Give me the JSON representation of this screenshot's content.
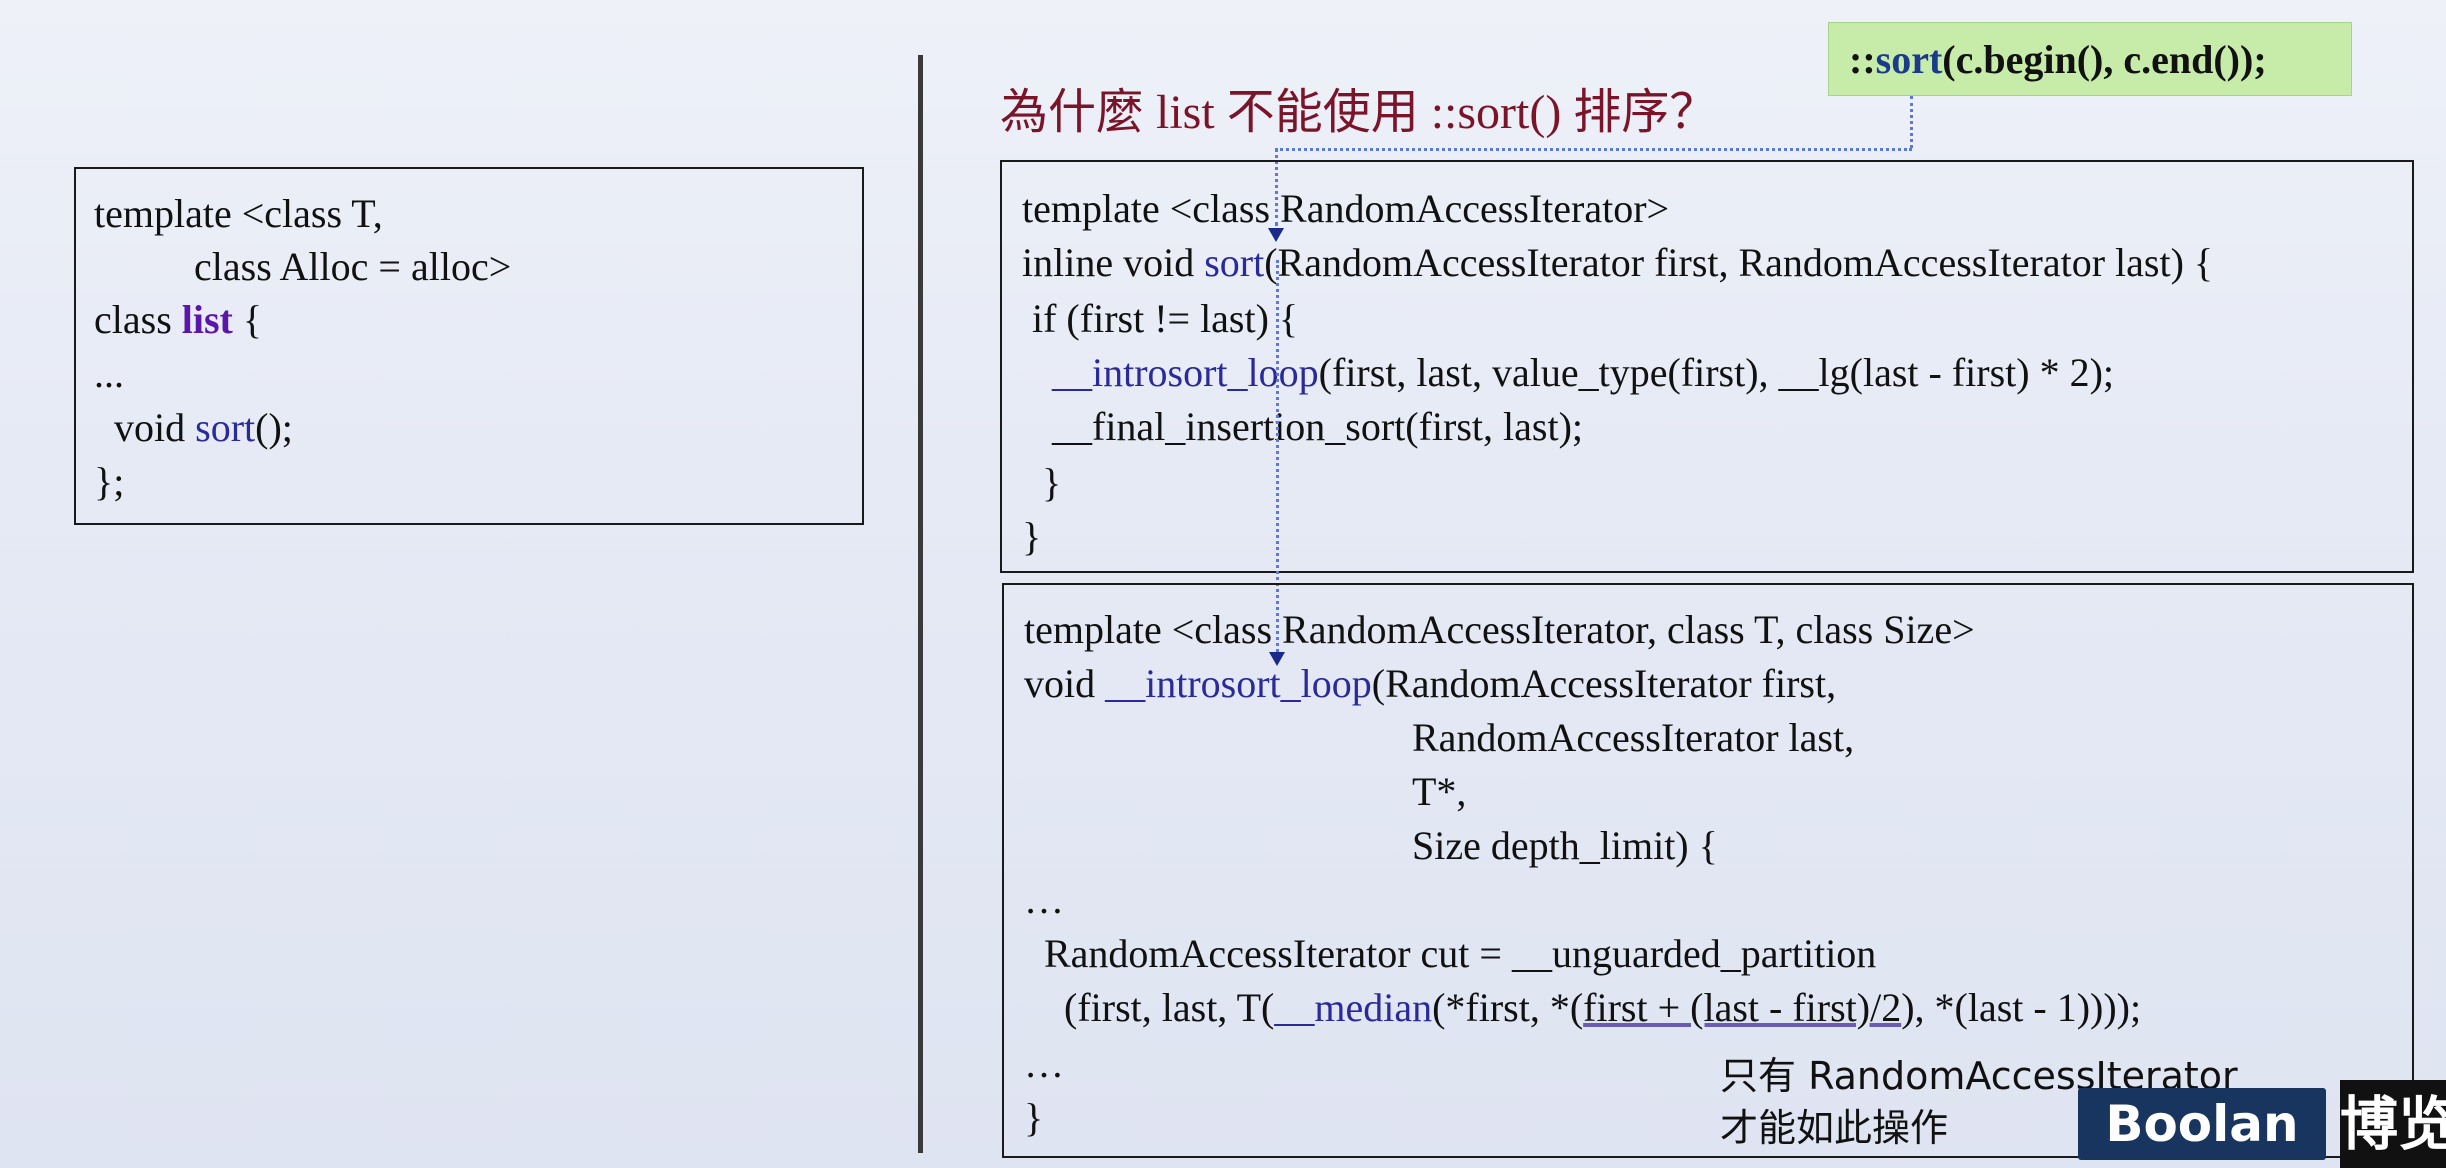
{
  "slide_title": "為什麼 list 不能使用 ::sort() 排序？",
  "callout": {
    "prefix": "::",
    "sort": "sort",
    "rest": "(c.begin(), c.end());"
  },
  "left_box": {
    "line1": "template <class T,",
    "line2": "          class Alloc = alloc>",
    "line3_pre": "class ",
    "line3_kw": "list",
    "line3_post": " {",
    "line4": "...",
    "line5_pre": "  void ",
    "line5_fn": "sort",
    "line5_post": "();",
    "line6": "};"
  },
  "sort_box": {
    "line1": "template <class RandomAccessIterator>",
    "line2_pre": "inline void ",
    "line2_fn": "sort",
    "line2_post": "(RandomAccessIterator first, RandomAccessIterator last) {",
    "line3": " if (first != last) {",
    "line4_pre": "   ",
    "line4_fn": "__introsort_loop",
    "line4_post": "(first, last, value_type(first), __lg(last - first) * 2);",
    "line5": "   __final_insertion_sort(first, last);",
    "line6": "  }",
    "line7": "}"
  },
  "introsort_box": {
    "line1": "template <class RandomAccessIterator, class T, class Size>",
    "line2_pre": "void ",
    "line2_fn": "__introsort_loop",
    "line2_post": "(RandomAccessIterator first,",
    "line3": "RandomAccessIterator last,",
    "line4": "T*,",
    "line5": "Size depth_limit) {",
    "line6": "…",
    "line7": "  RandomAccessIterator cut = __unguarded_partition",
    "line8_pre": "    (first, last, T(",
    "line8_fn": "__median",
    "line8_mid": "(*first, *(",
    "line8_ul": "first + (last - first)/2",
    "line8_post": "), *(last - 1))));",
    "line9": "…",
    "line10": "}"
  },
  "note": {
    "line1": "只有 RandomAccessIterator",
    "line2": "才能如此操作"
  },
  "logo": {
    "text": "Boolan",
    "cn": "博览"
  }
}
